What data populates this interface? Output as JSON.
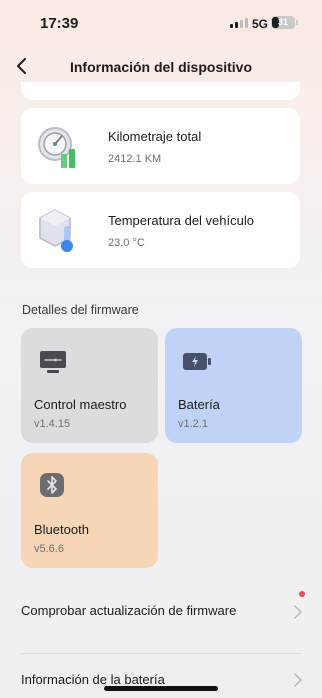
{
  "status_bar": {
    "time": "17:39",
    "network": "5G",
    "battery": "31"
  },
  "nav": {
    "title": "Información del dispositivo"
  },
  "cards": [
    {
      "label": "Kilometraje total",
      "value": "2412.1 KM",
      "icon": "gauge-icon"
    },
    {
      "label": "Temperatura del vehículo",
      "value": "23.0 °C",
      "icon": "thermometer-icon"
    }
  ],
  "firmware": {
    "title": "Detalles del firmware",
    "items": [
      {
        "label": "Control maestro",
        "value": "v1.4.15",
        "icon": "controller-icon",
        "color": "#dcdcdf"
      },
      {
        "label": "Batería",
        "value": "v1.2.1",
        "icon": "battery-icon",
        "color": "#c0d3f7"
      },
      {
        "label": "Bluetooth",
        "value": "v5.6.6",
        "icon": "bluetooth-icon",
        "color": "#f7d6b8"
      }
    ]
  },
  "rows": [
    {
      "label": "Comprobar actualización de firmware",
      "has_badge": true
    },
    {
      "label": "Información de la batería"
    }
  ],
  "colors": {
    "accent_red": "#ea4a5a",
    "card_bg": "#ffffff"
  }
}
